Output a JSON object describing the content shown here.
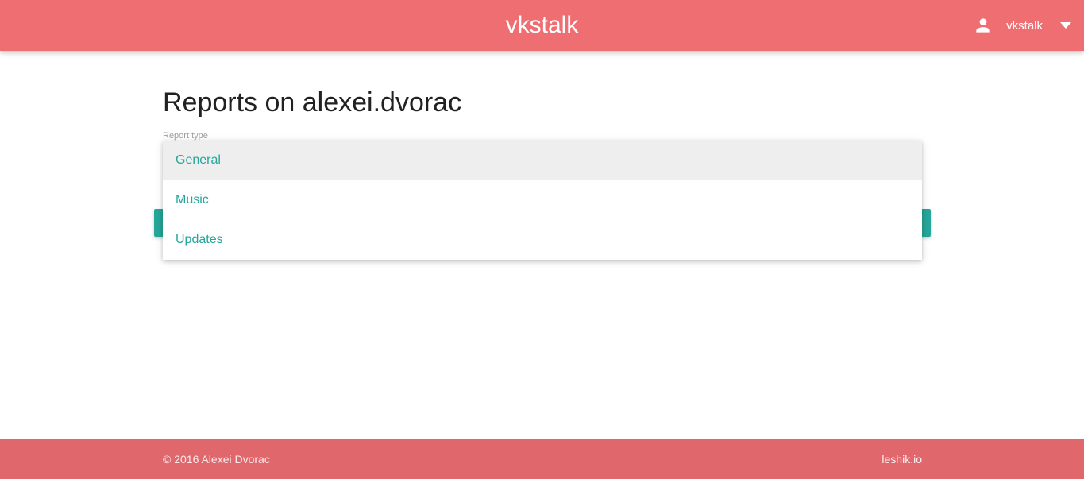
{
  "header": {
    "brand": "vkstalk",
    "user": {
      "icon": "person-icon",
      "name": "vkstalk",
      "menu_icon": "caret-down-icon"
    },
    "background_color": "#ef6e72"
  },
  "main": {
    "title": "Reports on alexei.dvorac",
    "report_type": {
      "label": "Report type",
      "selected": "General",
      "options": [
        "General",
        "Music",
        "Updates"
      ]
    },
    "accent_color": "#26a69a"
  },
  "footer": {
    "copyright": "© 2016 Alexei Dvorac",
    "link": "leshik.io",
    "background_color": "#e0686d"
  }
}
